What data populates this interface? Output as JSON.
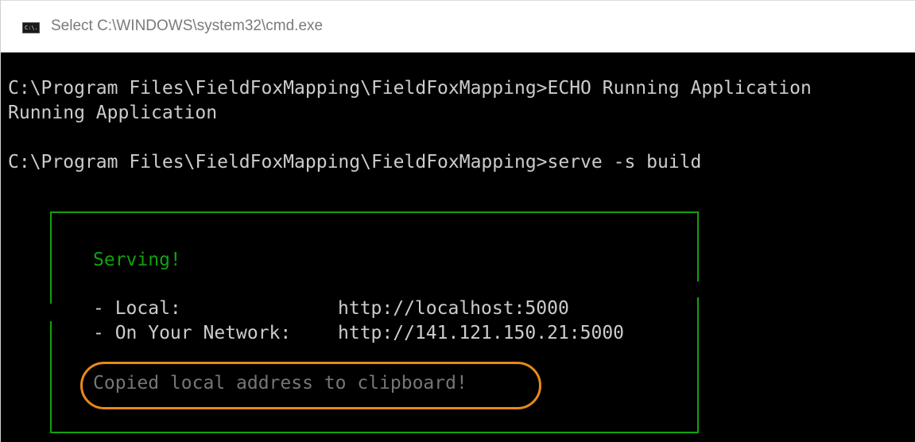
{
  "window": {
    "title": "Select C:\\WINDOWS\\system32\\cmd.exe",
    "icon": "cmd-icon",
    "icon_glyph": "C:\\."
  },
  "console": {
    "lines": [
      "C:\\Program Files\\FieldFoxMapping\\FieldFoxMapping>ECHO Running Application",
      "Running Application",
      "",
      "C:\\Program Files\\FieldFoxMapping\\FieldFoxMapping>serve -s build"
    ],
    "serve_box": {
      "heading": "Serving!",
      "local_label": "- Local:",
      "local_url": "http://localhost:5000",
      "network_label": "- On Your Network:",
      "network_url": "http://141.121.150.21:5000",
      "clipboard_message": "Copied local address to clipboard!"
    }
  },
  "colors": {
    "console_bg": "#000000",
    "console_text": "#cccccc",
    "serve_green": "#13a10e",
    "dim_text": "#767676",
    "highlight_orange": "#e8891a"
  }
}
